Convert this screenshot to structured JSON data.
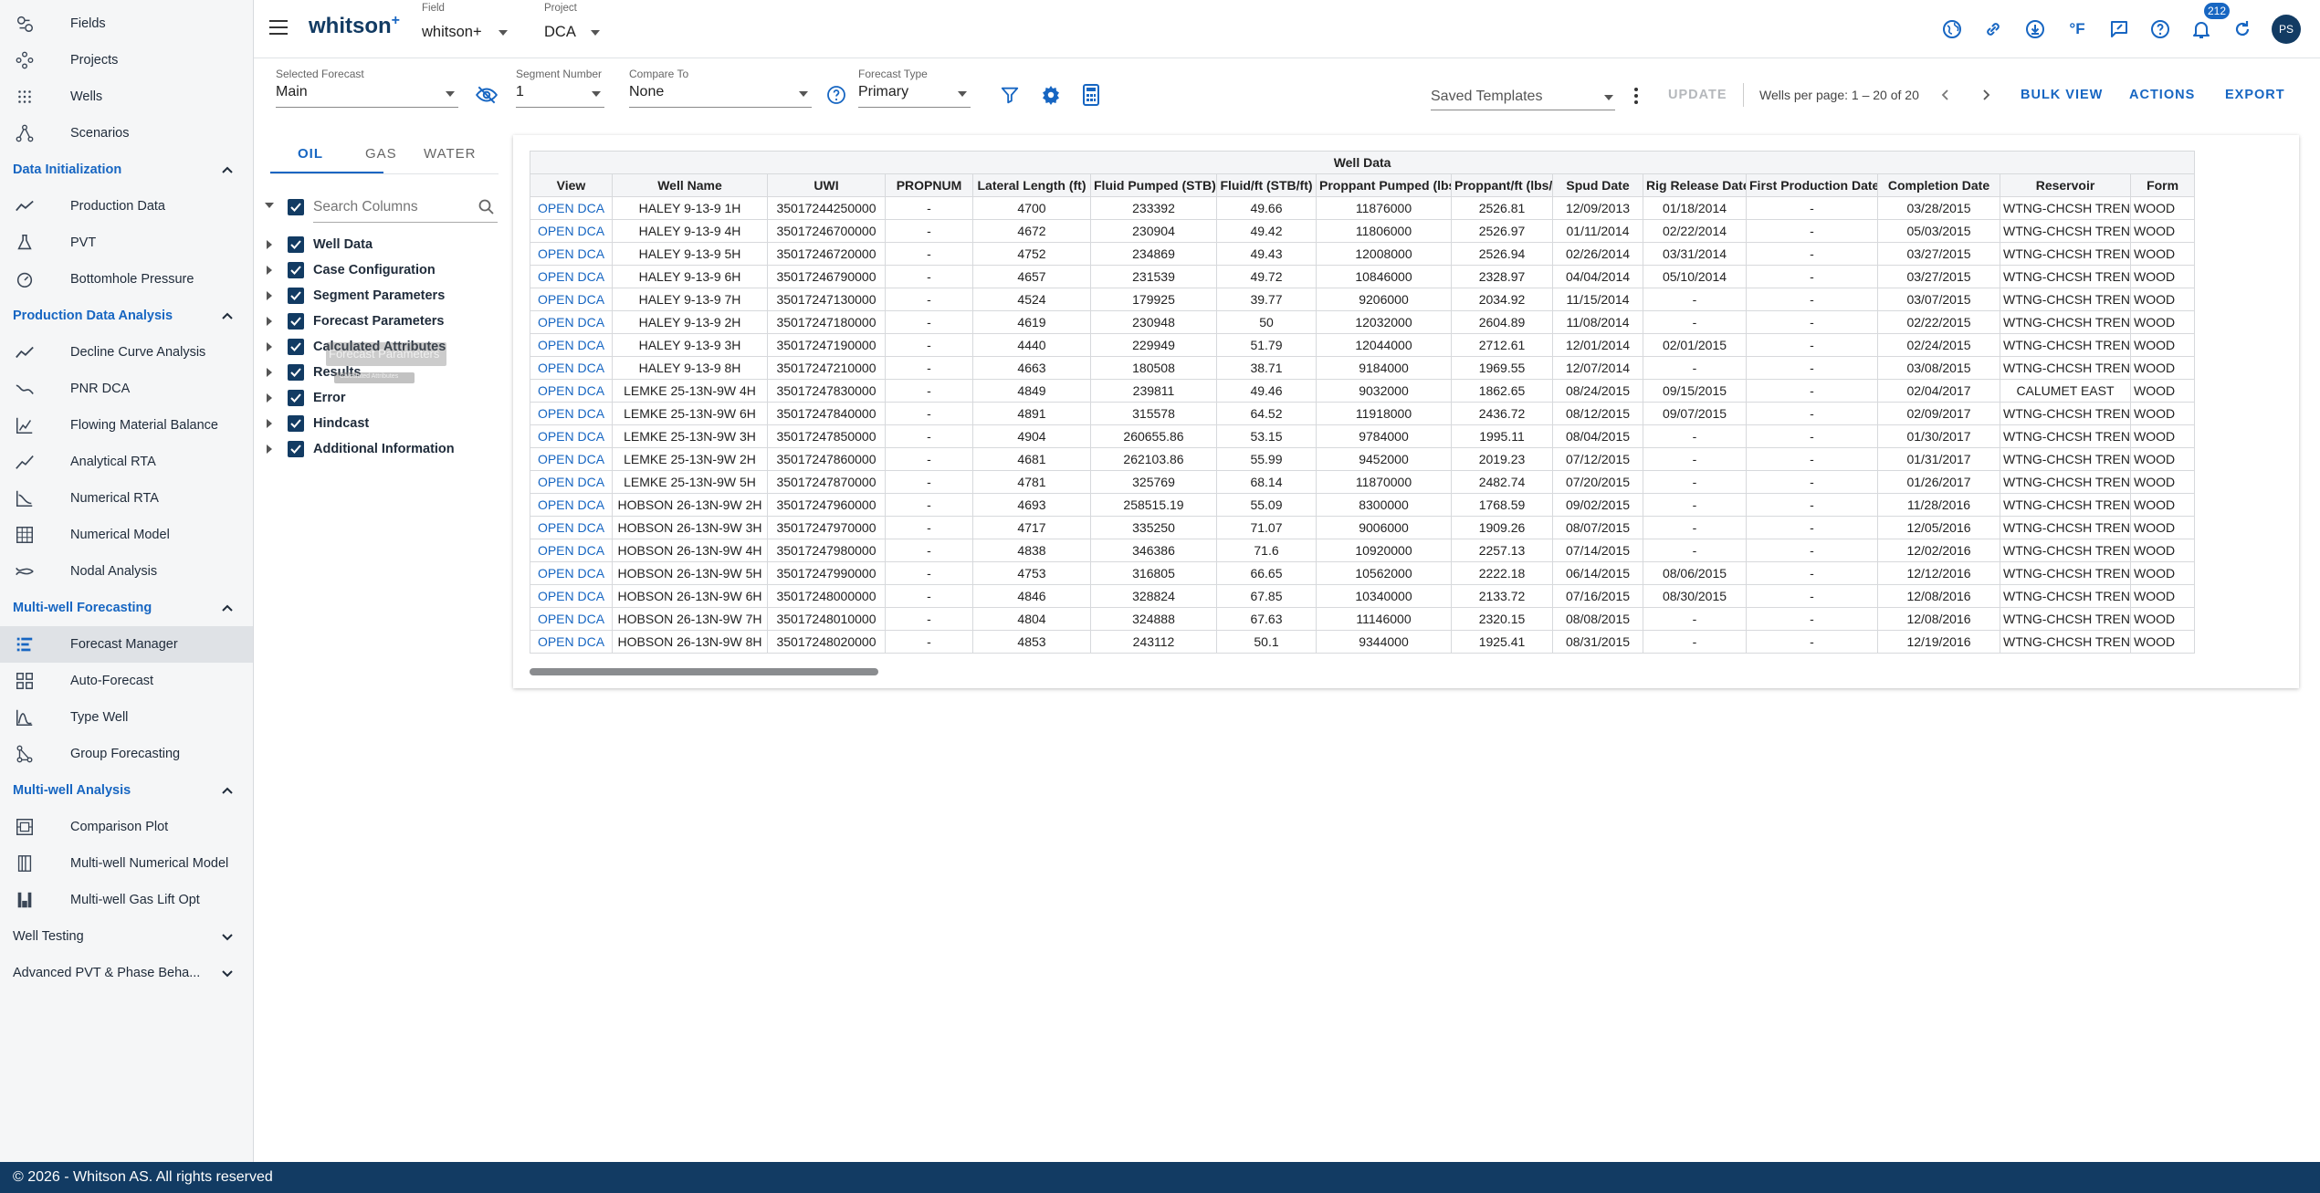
{
  "sidebar": {
    "items": [
      {
        "label": "Fields",
        "icon": "fields-icon"
      },
      {
        "label": "Projects",
        "icon": "projects-icon"
      },
      {
        "label": "Wells",
        "icon": "wells-icon"
      },
      {
        "label": "Scenarios",
        "icon": "scenarios-icon"
      }
    ],
    "sections": [
      {
        "title": "Data Initialization",
        "expanded": true,
        "items": [
          {
            "label": "Production Data",
            "icon": "production-data-icon"
          },
          {
            "label": "PVT",
            "icon": "pvt-flask-icon"
          },
          {
            "label": "Bottomhole Pressure",
            "icon": "bottomhole-pressure-icon"
          }
        ]
      },
      {
        "title": "Production Data Analysis",
        "expanded": true,
        "items": [
          {
            "label": "Decline Curve Analysis",
            "icon": "decline-curve-icon"
          },
          {
            "label": "PNR DCA",
            "icon": "pnr-dca-icon"
          },
          {
            "label": "Flowing Material Balance",
            "icon": "flowing-material-balance-icon"
          },
          {
            "label": "Analytical RTA",
            "icon": "analytical-rta-icon"
          },
          {
            "label": "Numerical RTA",
            "icon": "numerical-rta-icon"
          },
          {
            "label": "Numerical Model",
            "icon": "numerical-model-icon"
          },
          {
            "label": "Nodal Analysis",
            "icon": "nodal-analysis-icon"
          }
        ]
      },
      {
        "title": "Multi-well Forecasting",
        "expanded": true,
        "items": [
          {
            "label": "Forecast Manager",
            "icon": "forecast-manager-icon",
            "active": true
          },
          {
            "label": "Auto-Forecast",
            "icon": "auto-forecast-icon"
          },
          {
            "label": "Type Well",
            "icon": "type-well-icon"
          },
          {
            "label": "Group Forecasting",
            "icon": "group-forecasting-icon"
          }
        ]
      },
      {
        "title": "Multi-well Analysis",
        "expanded": true,
        "items": [
          {
            "label": "Comparison Plot",
            "icon": "comparison-plot-icon"
          },
          {
            "label": "Multi-well Numerical Model",
            "icon": "multiwell-numerical-model-icon"
          },
          {
            "label": "Multi-well Gas Lift Opt",
            "icon": "gas-lift-icon"
          }
        ]
      },
      {
        "title": "Well Testing",
        "expanded": false,
        "items": []
      },
      {
        "title": "Advanced PVT & Phase Behavior",
        "display_title": "Advanced PVT & Phase Beha...",
        "expanded": false,
        "items": []
      }
    ]
  },
  "header": {
    "logo": "whitson",
    "logo_sup": "+",
    "field_label": "Field",
    "field_value": "whitson+",
    "project_label": "Project",
    "project_value": "DCA",
    "notification_count": "212",
    "avatar_initials": "PS",
    "icons": [
      "globe-icon",
      "link-icon",
      "download-icon",
      "temperature-unit-icon",
      "feedback-icon",
      "help-icon",
      "notifications-icon",
      "refresh-icon"
    ],
    "temperature_unit": "°F"
  },
  "toolbar": {
    "selected_forecast_label": "Selected Forecast",
    "selected_forecast_value": "Main",
    "segment_number_label": "Segment Number",
    "segment_number_value": "1",
    "compare_to_label": "Compare To",
    "compare_to_value": "None",
    "forecast_type_label": "Forecast Type",
    "forecast_type_value": "Primary",
    "saved_templates_placeholder": "Saved Templates",
    "update_label": "UPDATE",
    "wells_per_page_text": "Wells per page: 1 – 20 of 20",
    "bulk_view_label": "BULK VIEW",
    "actions_label": "ACTIONS",
    "export_label": "EXPORT"
  },
  "column_panel": {
    "tabs": [
      "OIL",
      "GAS",
      "WATER"
    ],
    "active_tab": "OIL",
    "search_placeholder": "Search Columns",
    "groups": [
      "Well Data",
      "Case Configuration",
      "Segment Parameters",
      "Forecast Parameters",
      "Calculated Attributes",
      "Results",
      "Error",
      "Hindcast",
      "Additional Information"
    ],
    "drag_ghost_label": "Forecast Parameters",
    "drag_ghost_sub": "Calculated Attributes"
  },
  "grid": {
    "group_header": "Well Data",
    "columns": [
      "View",
      "Well Name",
      "UWI",
      "PROPNUM",
      "Lateral Length (ft)",
      "Fluid Pumped (STB)",
      "Fluid/ft (STB/ft)",
      "Proppant Pumped (lbs)",
      "Proppant/ft (lbs/ft)",
      "Spud Date",
      "Rig Release Date",
      "First Production Date",
      "Completion Date",
      "Reservoir",
      "Formation"
    ],
    "column_headers_display": [
      "View",
      "Well Name",
      "UWI",
      "PROPNUM",
      "Lateral Length (ft)",
      "Fluid Pumped (STB)",
      "Fluid/ft (STB/ft)",
      "Proppant Pumped (lbs)",
      "Proppant/ft (lbs/ft)",
      "Spud Date",
      "Rig Release Date",
      "First Production Date",
      "Completion Date",
      "Reservoir",
      "Form"
    ],
    "rows": [
      [
        "OPEN DCA",
        "HALEY 9-13-9 1H",
        "35017244250000",
        "-",
        "4700",
        "233392",
        "49.66",
        "11876000",
        "2526.81",
        "12/09/2013",
        "01/18/2014",
        "-",
        "03/28/2015",
        "WTNG-CHCSH TREND",
        "WOOD"
      ],
      [
        "OPEN DCA",
        "HALEY 9-13-9 4H",
        "35017246700000",
        "-",
        "4672",
        "230904",
        "49.42",
        "11806000",
        "2526.97",
        "01/11/2014",
        "02/22/2014",
        "-",
        "05/03/2015",
        "WTNG-CHCSH TREND",
        "WOOD"
      ],
      [
        "OPEN DCA",
        "HALEY 9-13-9 5H",
        "35017246720000",
        "-",
        "4752",
        "234869",
        "49.43",
        "12008000",
        "2526.94",
        "02/26/2014",
        "03/31/2014",
        "-",
        "03/27/2015",
        "WTNG-CHCSH TREND",
        "WOOD"
      ],
      [
        "OPEN DCA",
        "HALEY 9-13-9 6H",
        "35017246790000",
        "-",
        "4657",
        "231539",
        "49.72",
        "10846000",
        "2328.97",
        "04/04/2014",
        "05/10/2014",
        "-",
        "03/27/2015",
        "WTNG-CHCSH TREND",
        "WOOD"
      ],
      [
        "OPEN DCA",
        "HALEY 9-13-9 7H",
        "35017247130000",
        "-",
        "4524",
        "179925",
        "39.77",
        "9206000",
        "2034.92",
        "11/15/2014",
        "-",
        "-",
        "03/07/2015",
        "WTNG-CHCSH TREND",
        "WOOD"
      ],
      [
        "OPEN DCA",
        "HALEY 9-13-9 2H",
        "35017247180000",
        "-",
        "4619",
        "230948",
        "50",
        "12032000",
        "2604.89",
        "11/08/2014",
        "-",
        "-",
        "02/22/2015",
        "WTNG-CHCSH TREND",
        "WOOD"
      ],
      [
        "OPEN DCA",
        "HALEY 9-13-9 3H",
        "35017247190000",
        "-",
        "4440",
        "229949",
        "51.79",
        "12044000",
        "2712.61",
        "12/01/2014",
        "02/01/2015",
        "-",
        "02/24/2015",
        "WTNG-CHCSH TREND",
        "WOOD"
      ],
      [
        "OPEN DCA",
        "HALEY 9-13-9 8H",
        "35017247210000",
        "-",
        "4663",
        "180508",
        "38.71",
        "9184000",
        "1969.55",
        "12/07/2014",
        "-",
        "-",
        "03/08/2015",
        "WTNG-CHCSH TREND",
        "WOOD"
      ],
      [
        "OPEN DCA",
        "LEMKE 25-13N-9W 4H",
        "35017247830000",
        "-",
        "4849",
        "239811",
        "49.46",
        "9032000",
        "1862.65",
        "08/24/2015",
        "09/15/2015",
        "-",
        "02/04/2017",
        "CALUMET EAST",
        "WOOD"
      ],
      [
        "OPEN DCA",
        "LEMKE 25-13N-9W 6H",
        "35017247840000",
        "-",
        "4891",
        "315578",
        "64.52",
        "11918000",
        "2436.72",
        "08/12/2015",
        "09/07/2015",
        "-",
        "02/09/2017",
        "WTNG-CHCSH TREND",
        "WOOD"
      ],
      [
        "OPEN DCA",
        "LEMKE 25-13N-9W 3H",
        "35017247850000",
        "-",
        "4904",
        "260655.86",
        "53.15",
        "9784000",
        "1995.11",
        "08/04/2015",
        "-",
        "-",
        "01/30/2017",
        "WTNG-CHCSH TREND",
        "WOOD"
      ],
      [
        "OPEN DCA",
        "LEMKE 25-13N-9W 2H",
        "35017247860000",
        "-",
        "4681",
        "262103.86",
        "55.99",
        "9452000",
        "2019.23",
        "07/12/2015",
        "-",
        "-",
        "01/31/2017",
        "WTNG-CHCSH TREND",
        "WOOD"
      ],
      [
        "OPEN DCA",
        "LEMKE 25-13N-9W 5H",
        "35017247870000",
        "-",
        "4781",
        "325769",
        "68.14",
        "11870000",
        "2482.74",
        "07/20/2015",
        "-",
        "-",
        "01/26/2017",
        "WTNG-CHCSH TREND",
        "WOOD"
      ],
      [
        "OPEN DCA",
        "HOBSON 26-13N-9W 2H",
        "35017247960000",
        "-",
        "4693",
        "258515.19",
        "55.09",
        "8300000",
        "1768.59",
        "09/02/2015",
        "-",
        "-",
        "11/28/2016",
        "WTNG-CHCSH TREND",
        "WOOD"
      ],
      [
        "OPEN DCA",
        "HOBSON 26-13N-9W 3H",
        "35017247970000",
        "-",
        "4717",
        "335250",
        "71.07",
        "9006000",
        "1909.26",
        "08/07/2015",
        "-",
        "-",
        "12/05/2016",
        "WTNG-CHCSH TREND",
        "WOOD"
      ],
      [
        "OPEN DCA",
        "HOBSON 26-13N-9W 4H",
        "35017247980000",
        "-",
        "4838",
        "346386",
        "71.6",
        "10920000",
        "2257.13",
        "07/14/2015",
        "-",
        "-",
        "12/02/2016",
        "WTNG-CHCSH TREND",
        "WOOD"
      ],
      [
        "OPEN DCA",
        "HOBSON 26-13N-9W 5H",
        "35017247990000",
        "-",
        "4753",
        "316805",
        "66.65",
        "10562000",
        "2222.18",
        "06/14/2015",
        "08/06/2015",
        "-",
        "12/12/2016",
        "WTNG-CHCSH TREND",
        "WOOD"
      ],
      [
        "OPEN DCA",
        "HOBSON 26-13N-9W 6H",
        "35017248000000",
        "-",
        "4846",
        "328824",
        "67.85",
        "10340000",
        "2133.72",
        "07/16/2015",
        "08/30/2015",
        "-",
        "12/08/2016",
        "WTNG-CHCSH TREND",
        "WOOD"
      ],
      [
        "OPEN DCA",
        "HOBSON 26-13N-9W 7H",
        "35017248010000",
        "-",
        "4804",
        "324888",
        "67.63",
        "11146000",
        "2320.15",
        "08/08/2015",
        "-",
        "-",
        "12/08/2016",
        "WTNG-CHCSH TREND",
        "WOOD"
      ],
      [
        "OPEN DCA",
        "HOBSON 26-13N-9W 8H",
        "35017248020000",
        "-",
        "4853",
        "243112",
        "50.1",
        "9344000",
        "1925.41",
        "08/31/2015",
        "-",
        "-",
        "12/19/2016",
        "WTNG-CHCSH TREND",
        "WOOD"
      ]
    ]
  },
  "footer": {
    "text": "© 2026 - Whitson AS. All rights reserved"
  },
  "colors": {
    "accent": "#1766c2",
    "navy": "#123b63",
    "sidebar_bg": "#f5f6f7",
    "active_item": "#dfe2e6"
  }
}
